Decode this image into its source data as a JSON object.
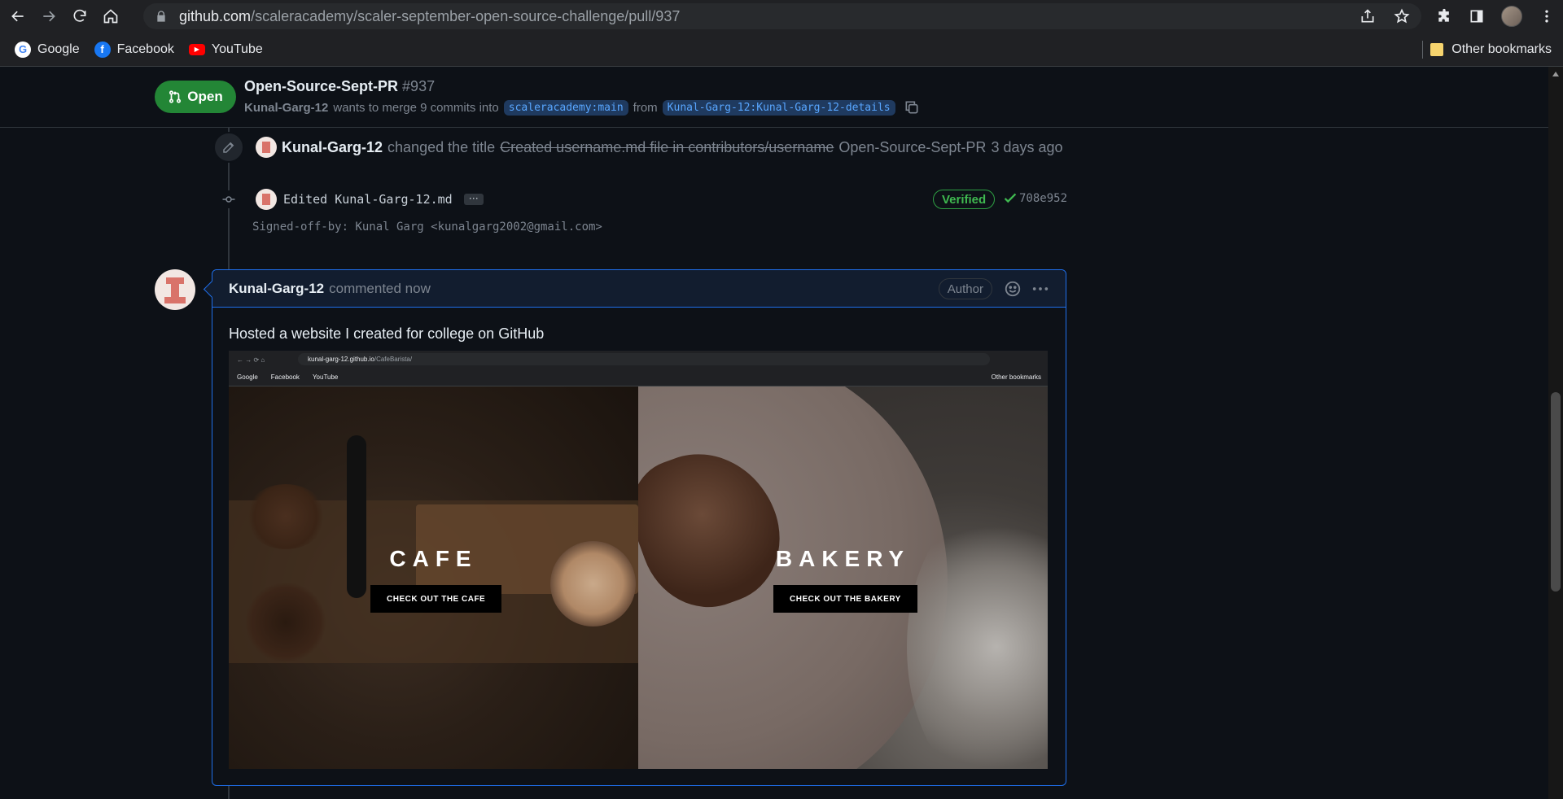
{
  "browser": {
    "url_host": "github.com",
    "url_path": "/scaleracademy/scaler-september-open-source-challenge/pull/937",
    "bookmarks": [
      {
        "label": "Google",
        "color": "#4285f4",
        "glyph": "G"
      },
      {
        "label": "Facebook",
        "color": "#1877f2",
        "glyph": "f"
      },
      {
        "label": "YouTube",
        "color": "#ff0000",
        "glyph": "▶"
      }
    ],
    "other_bookmarks": "Other bookmarks"
  },
  "pr": {
    "state": "Open",
    "title": "Open-Source-Sept-PR",
    "number": "#937",
    "author": "Kunal-Garg-12",
    "merge_text": "wants to merge 9 commits into",
    "base_branch": "scaleracademy:main",
    "from_text": "from",
    "head_branch": "Kunal-Garg-12:Kunal-Garg-12-details"
  },
  "rename_event": {
    "actor": "Kunal-Garg-12",
    "action": "changed the title",
    "old_title": "Created username.md file in contributors/username",
    "new_title": "Open-Source-Sept-PR",
    "time": "3 days ago"
  },
  "commit": {
    "message": "Edited Kunal-Garg-12.md",
    "ellipsis": "···",
    "verified": "Verified",
    "sha": "708e952",
    "signoff": "Signed-off-by: Kunal Garg <kunalgarg2002@gmail.com>"
  },
  "comment": {
    "author": "Kunal-Garg-12",
    "meta": "commented now",
    "badge": "Author",
    "body": "Hosted a website I created for college on GitHub",
    "screenshot": {
      "url_host": "kunal-garg-12.github.io",
      "url_path": "/CafeBarista/",
      "bookmarks": [
        "Google",
        "Facebook",
        "YouTube"
      ],
      "other_bookmarks": "Other bookmarks",
      "left_title": "CAFE",
      "left_button": "CHECK OUT THE CAFE",
      "right_title": "BAKERY",
      "right_button": "CHECK OUT THE BAKERY"
    }
  },
  "colors": {
    "open_green": "#238636",
    "accent_blue": "#1f6feb",
    "verified_green": "#3fb950"
  }
}
